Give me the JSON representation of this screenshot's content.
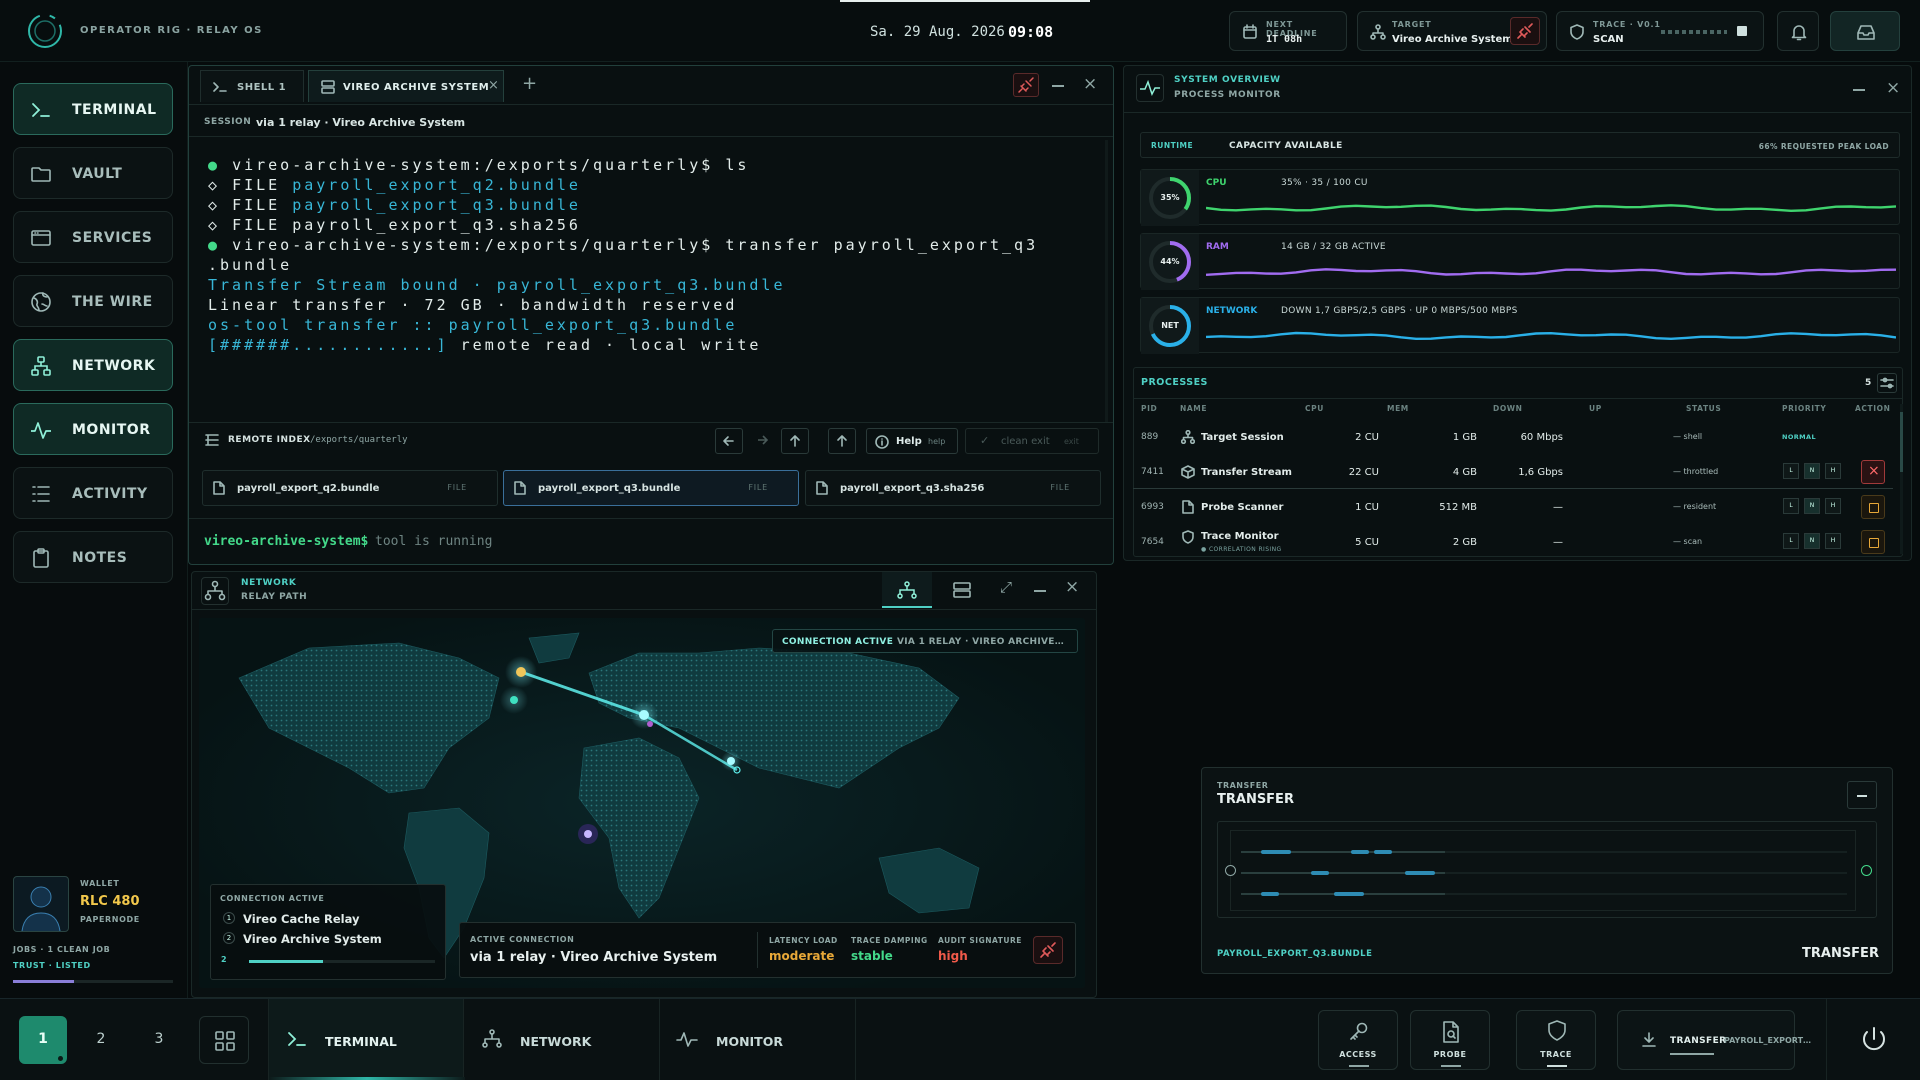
{
  "topbar": {
    "rig_label": "OPERATOR RIG · RELAY OS",
    "date": "Sa. 29 Aug. 2026",
    "time": "09:08",
    "deadline_label": "NEXT DEADLINE",
    "deadline_value": "1T 08h",
    "target_label": "TARGET",
    "target_value": "Vireo Archive System",
    "trace_label": "TRACE · V0.1",
    "trace_value": "SCAN"
  },
  "sidebar": {
    "items": [
      {
        "label": "TERMINAL",
        "icon": "terminal-icon",
        "active": true
      },
      {
        "label": "VAULT",
        "icon": "folder-icon",
        "active": false
      },
      {
        "label": "SERVICES",
        "icon": "browser-icon",
        "active": false
      },
      {
        "label": "THE WIRE",
        "icon": "globe-icon",
        "active": false
      },
      {
        "label": "NETWORK",
        "icon": "network-icon",
        "active": true
      },
      {
        "label": "MONITOR",
        "icon": "pulse-icon",
        "active": true
      },
      {
        "label": "ACTIVITY",
        "icon": "list-icon",
        "active": false
      },
      {
        "label": "NOTES",
        "icon": "clipboard-icon",
        "active": false
      }
    ],
    "wallet_label": "WALLET",
    "wallet_value": "RLC 480",
    "node": "PAPERNODE",
    "jobs": "JOBS · 1 CLEAN JOB",
    "trust": "TRUST · LISTED",
    "trust_level": 0.38
  },
  "terminal": {
    "tabs": [
      {
        "label": "SHELL 1",
        "icon": "terminal-icon"
      },
      {
        "label": "VIREO ARCHIVE SYSTEM",
        "icon": "server-icon"
      }
    ],
    "session_label": "SESSION",
    "session_value": "via 1 relay · Vireo Archive System",
    "lines": [
      {
        "bullet": "●",
        "text": "vireo-archive-system:/exports/quarterly$ ls"
      },
      {
        "bullet": "◇",
        "prefix": "FILE ",
        "text": "payroll_export_q2.bundle"
      },
      {
        "bullet": "◇",
        "prefix": "FILE ",
        "text": "payroll_export_q3.bundle"
      },
      {
        "bullet": "◇",
        "prefix": "FILE ",
        "text": "payroll_export_q3.sha256"
      },
      {
        "bullet": "●",
        "text": "vireo-archive-system:/exports/quarterly$ transfer payroll_export_q3"
      },
      {
        "bullet": "",
        "text": ".bundle"
      },
      {
        "bullet": "",
        "text": "Transfer Stream bound · payroll_export_q3.bundle"
      },
      {
        "bullet": "",
        "text": "Linear transfer · 72 GB · bandwidth reserved"
      },
      {
        "bullet": "",
        "text": ""
      },
      {
        "bullet": "",
        "text": "os-tool transfer :: payroll_export_q3.bundle"
      },
      {
        "bullet": "",
        "text": "[######............]",
        "suffix": " remote read · local write"
      }
    ],
    "remote_index_label": "REMOTE INDEX",
    "remote_index_path": "/exports/quarterly",
    "help_label": "Help",
    "help_hint": "help",
    "clean_exit_label": "clean exit",
    "clean_exit_hint": "exit",
    "files": [
      {
        "name": "payroll_export_q2.bundle",
        "type": "FILE"
      },
      {
        "name": "payroll_export_q3.bundle",
        "type": "FILE"
      },
      {
        "name": "payroll_export_q3.sha256",
        "type": "FILE"
      }
    ],
    "prompt": "vireo-archive-system$",
    "prompt_input": "tool is running"
  },
  "system": {
    "title": "SYSTEM OVERVIEW",
    "subtitle": "PROCESS MONITOR",
    "runtime_label": "RUNTIME",
    "capacity_label": "CAPACITY AVAILABLE",
    "peak_label": "66% REQUESTED PEAK LOAD",
    "gauges": [
      {
        "ring": "35%",
        "name": "CPU",
        "detail": "35% · 35 / 100 CU",
        "color": "#3fd46e",
        "pct": 0.35
      },
      {
        "ring": "44%",
        "name": "RAM",
        "detail": "14 GB / 32 GB ACTIVE",
        "color": "#a16cf0",
        "pct": 0.44
      },
      {
        "ring": "NET",
        "name": "NETWORK",
        "detail": "DOWN 1,7 GBPS/2,5 GBPS · UP 0 MBPS/500 MBPS",
        "color": "#2ab0e8",
        "pct": 0.68
      }
    ],
    "processes_label": "PROCESSES",
    "process_count": "5",
    "columns": [
      "PID",
      "NAME",
      "CPU",
      "MEM",
      "DOWN",
      "UP",
      "STATUS",
      "PRIORITY",
      "ACTION"
    ],
    "processes": [
      {
        "pid": "889",
        "name": "Target Session",
        "icon": "network-icon",
        "cpu": "2 CU",
        "mem": "1 GB",
        "down": "60 Mbps",
        "up": "",
        "status": "— shell",
        "priority": "NORMAL"
      },
      {
        "pid": "7411",
        "name": "Transfer Stream",
        "icon": "cube-icon",
        "cpu": "22 CU",
        "mem": "4 GB",
        "down": "1,6 Gbps",
        "up": "",
        "status": "— throttled",
        "priority": ""
      },
      {
        "pid": "6993",
        "name": "Probe Scanner",
        "icon": "file-icon",
        "cpu": "1 CU",
        "mem": "512 MB",
        "down": "—",
        "up": "",
        "status": "— resident",
        "priority": ""
      },
      {
        "pid": "7654",
        "name": "Trace Monitor",
        "icon": "shield-icon",
        "sub": "● CORRELATION RISING",
        "cpu": "5 CU",
        "mem": "2 GB",
        "down": "—",
        "up": "",
        "status": "— scan",
        "priority": ""
      }
    ],
    "priority_letters": [
      "L",
      "N",
      "H"
    ]
  },
  "network": {
    "title": "NETWORK",
    "subtitle": "RELAY PATH",
    "connection_status": "CONNECTION ACTIVE",
    "connection_detail": "VIA 1 RELAY · VIREO ARCHIVE…",
    "card_label": "CONNECTION ACTIVE",
    "hops": [
      {
        "num": "1",
        "name": "Vireo Cache Relay"
      },
      {
        "num": "2",
        "name": "Vireo Archive System"
      }
    ],
    "hop_progress_label": "2",
    "hop_progress": 0.4,
    "active_label": "ACTIVE CONNECTION",
    "active_value": "via 1 relay · Vireo Archive System",
    "latency_label": "LATENCY LOAD",
    "latency_value": "moderate",
    "damping_label": "TRACE DAMPING",
    "damping_value": "stable",
    "audit_label": "AUDIT SIGNATURE",
    "audit_value": "high",
    "colors": {
      "moderate": "#e8a838",
      "stable": "#43d98a",
      "high": "#f05a4a"
    }
  },
  "transfer": {
    "small_label": "TRANSFER",
    "title": "TRANSFER",
    "file": "PAYROLL_EXPORT_Q3.BUNDLE",
    "action": "TRANSFER"
  },
  "bottombar": {
    "workspaces": [
      "1",
      "2",
      "3"
    ],
    "tabs": [
      {
        "label": "TERMINAL",
        "icon": "terminal-icon"
      },
      {
        "label": "NETWORK",
        "icon": "network-icon"
      },
      {
        "label": "MONITOR",
        "icon": "pulse-icon"
      }
    ],
    "tools": [
      {
        "label": "ACCESS",
        "icon": "key-icon"
      },
      {
        "label": "PROBE",
        "icon": "file-search-icon"
      },
      {
        "label": "TRACE",
        "icon": "shield-icon"
      }
    ],
    "transfer_label": "TRANSFER",
    "transfer_file": "PAYROLL_EXPORT…"
  }
}
